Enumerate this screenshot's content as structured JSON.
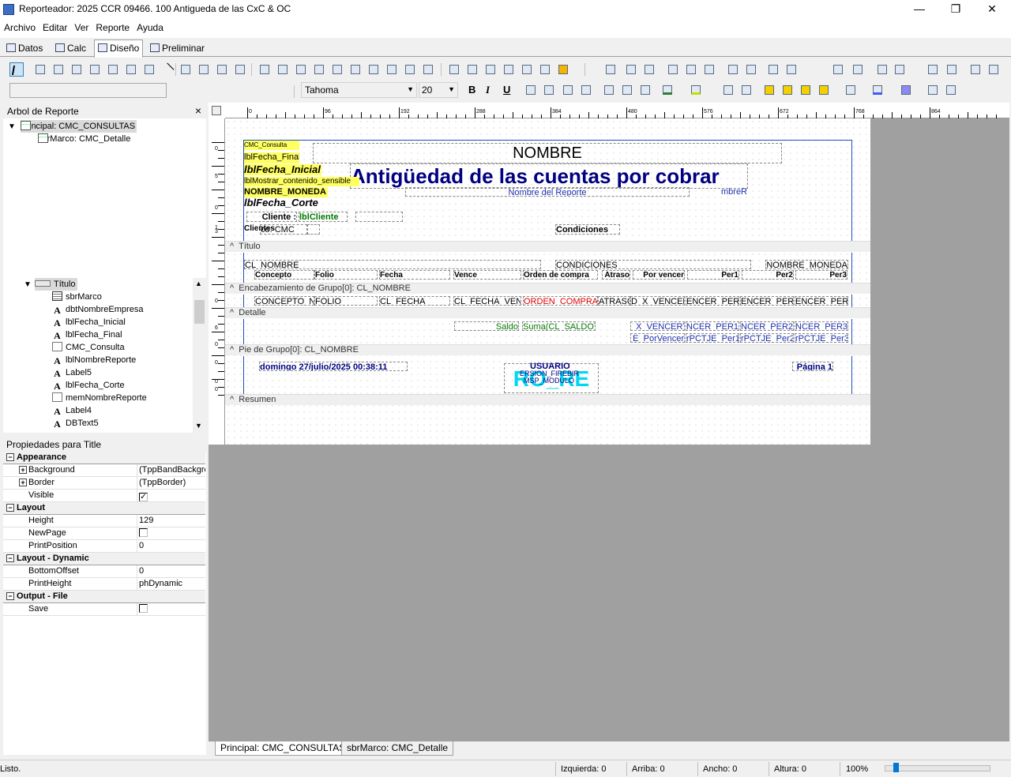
{
  "window": {
    "title": "Reporteador: 2025 CCR 09466. 100 Antigueda de las CxC & OC",
    "minimize": "—",
    "maximize": "❐",
    "close": "✕"
  },
  "menu": [
    "Archivo",
    "Editar",
    "Ver",
    "Reporte",
    "Ayuda"
  ],
  "tabs": {
    "datos": "Datos",
    "calc": "Calc",
    "diseno": "Diseño",
    "preliminar": "Preliminar"
  },
  "format": {
    "font": "Tahoma",
    "size": "20",
    "bold": "B",
    "italic": "I",
    "underline": "U"
  },
  "tree": {
    "header": "Arbol de Reporte",
    "close": "×",
    "nodes": [
      "Principal: CMC_CONSULTAS",
      "sbrMarco: CMC_Detalle",
      "Título",
      "sbrMarco",
      "dbtNombreEmpresa",
      "lblFecha_Inicial",
      "lblFecha_Final",
      "CMC_Consulta",
      "lblNombreReporte",
      "Label5",
      "lblFecha_Corte",
      "memNombreReporte",
      "Label4",
      "DBText5"
    ],
    "expand": "⌄",
    "collapse": "⌄"
  },
  "props": {
    "title": "Propiedades para Title",
    "rows": [
      {
        "type": "cat",
        "name": "Appearance",
        "box": "−"
      },
      {
        "type": "prop",
        "name": "Background",
        "value": "(TppBandBackground)",
        "box": "+"
      },
      {
        "type": "prop",
        "name": "Border",
        "value": "(TppBorder)",
        "box": "+"
      },
      {
        "type": "prop",
        "name": "Visible",
        "value": "✓",
        "check": true
      },
      {
        "type": "cat",
        "name": "Layout",
        "box": "−"
      },
      {
        "type": "prop",
        "name": "Height",
        "value": "129"
      },
      {
        "type": "prop",
        "name": "NewPage",
        "value": "",
        "check": true
      },
      {
        "type": "prop",
        "name": "PrintPosition",
        "value": "0"
      },
      {
        "type": "cat",
        "name": "Layout - Dynamic",
        "box": "−"
      },
      {
        "type": "prop",
        "name": "BottomOffset",
        "value": "0"
      },
      {
        "type": "prop",
        "name": "PrintHeight",
        "value": "phDynamic"
      },
      {
        "type": "cat",
        "name": "Output - File",
        "box": "−"
      },
      {
        "type": "prop",
        "name": "Save",
        "value": "",
        "check": true
      }
    ]
  },
  "ruler": {
    "top": [
      "0",
      "96",
      "192",
      "288",
      "384",
      "480",
      "576",
      "672",
      "768",
      "864"
    ],
    "left": [
      "0",
      "5",
      "0",
      "1",
      "3",
      "6",
      "0",
      "0",
      "0",
      "0",
      "0"
    ]
  },
  "report": {
    "title_band": {
      "cmc_consulta": "CMC_Consulta",
      "lbl_fecha_final": "lblFecha_Final",
      "nombre": "NOMBRE",
      "lbl_fecha_inicial": "lblFecha_Inicial",
      "heading": "Antigüedad de las cuentas por cobrar",
      "lbl_mostrar": "lblMostrar_contenido_sensible",
      "nombre_moneda": "NOMBRE_MONEDA",
      "nombre_reporte": "Nombre del Reporte",
      "nombre_reporte_clip": "mbreR",
      "lbl_fecha_corte": "lblFecha_Corte",
      "cliente": "Cliente :",
      "lbl_cliente": "lblCliente",
      "cliente_overlap": "Clientes",
      "consulta_clip": "co: CMC",
      "condiciones": "Condiciones"
    },
    "bands": {
      "titulo": "Título",
      "encabezado": "Encabezamiento de Grupo[0]: CL_NOMBRE",
      "detalle": "Detalle",
      "pie": "Pie de Grupo[0]: CL_NOMBRE",
      "resumen": "Resumen",
      "arrow": "^"
    },
    "group_header": {
      "cl_nombre": "CL_NOMBRE",
      "condiciones": "CONDICIONES",
      "nombre_moneda": "NOMBRE_MONEDA",
      "cols": [
        "Concepto",
        "Folio",
        "Fecha",
        "Vence",
        "Orden de compra",
        "Atraso",
        "Por vencer",
        "Per1",
        "Per2",
        "Per3"
      ]
    },
    "detail": [
      "CONCEPTO_N",
      "FOLIO",
      "CL_FECHA",
      "CL_FECHA_VEN",
      "ORDEN_COMPRA",
      "ATRASO",
      "D_X_VENCER",
      "ENCER_PER1",
      "ENCER_PER2",
      "ENCER_PER3"
    ],
    "group_footer": {
      "saldo": "Saldo",
      "suma": "Suma(CL_SALDO)",
      "sums": [
        "_X_VENCER)",
        "NCER_PER1)",
        "NCER_PER2)",
        "NCER_PER3)"
      ],
      "pcts": [
        "E_PorVencer",
        "rPCTJE_Per1",
        "rPCTJE_Per2",
        "rPCTJE_Per3"
      ]
    },
    "summary": {
      "fecha": "domingo 27/julio/2025 00:38:11",
      "usuario": "USUARIO",
      "version": "ERSION_FIREBIR",
      "modulo": "MSP_MODULO",
      "big": "RO_RE",
      "pagina": "Página 1"
    }
  },
  "bottom_tabs": [
    "Principal: CMC_CONSULTAS",
    "sbrMarco: CMC_Detalle"
  ],
  "status": {
    "listo": "Listo.",
    "izquierda": "Izquierda: 0",
    "arriba": "Arriba: 0",
    "ancho": "Ancho: 0",
    "altura": "Altura: 0",
    "zoom": "100%"
  }
}
